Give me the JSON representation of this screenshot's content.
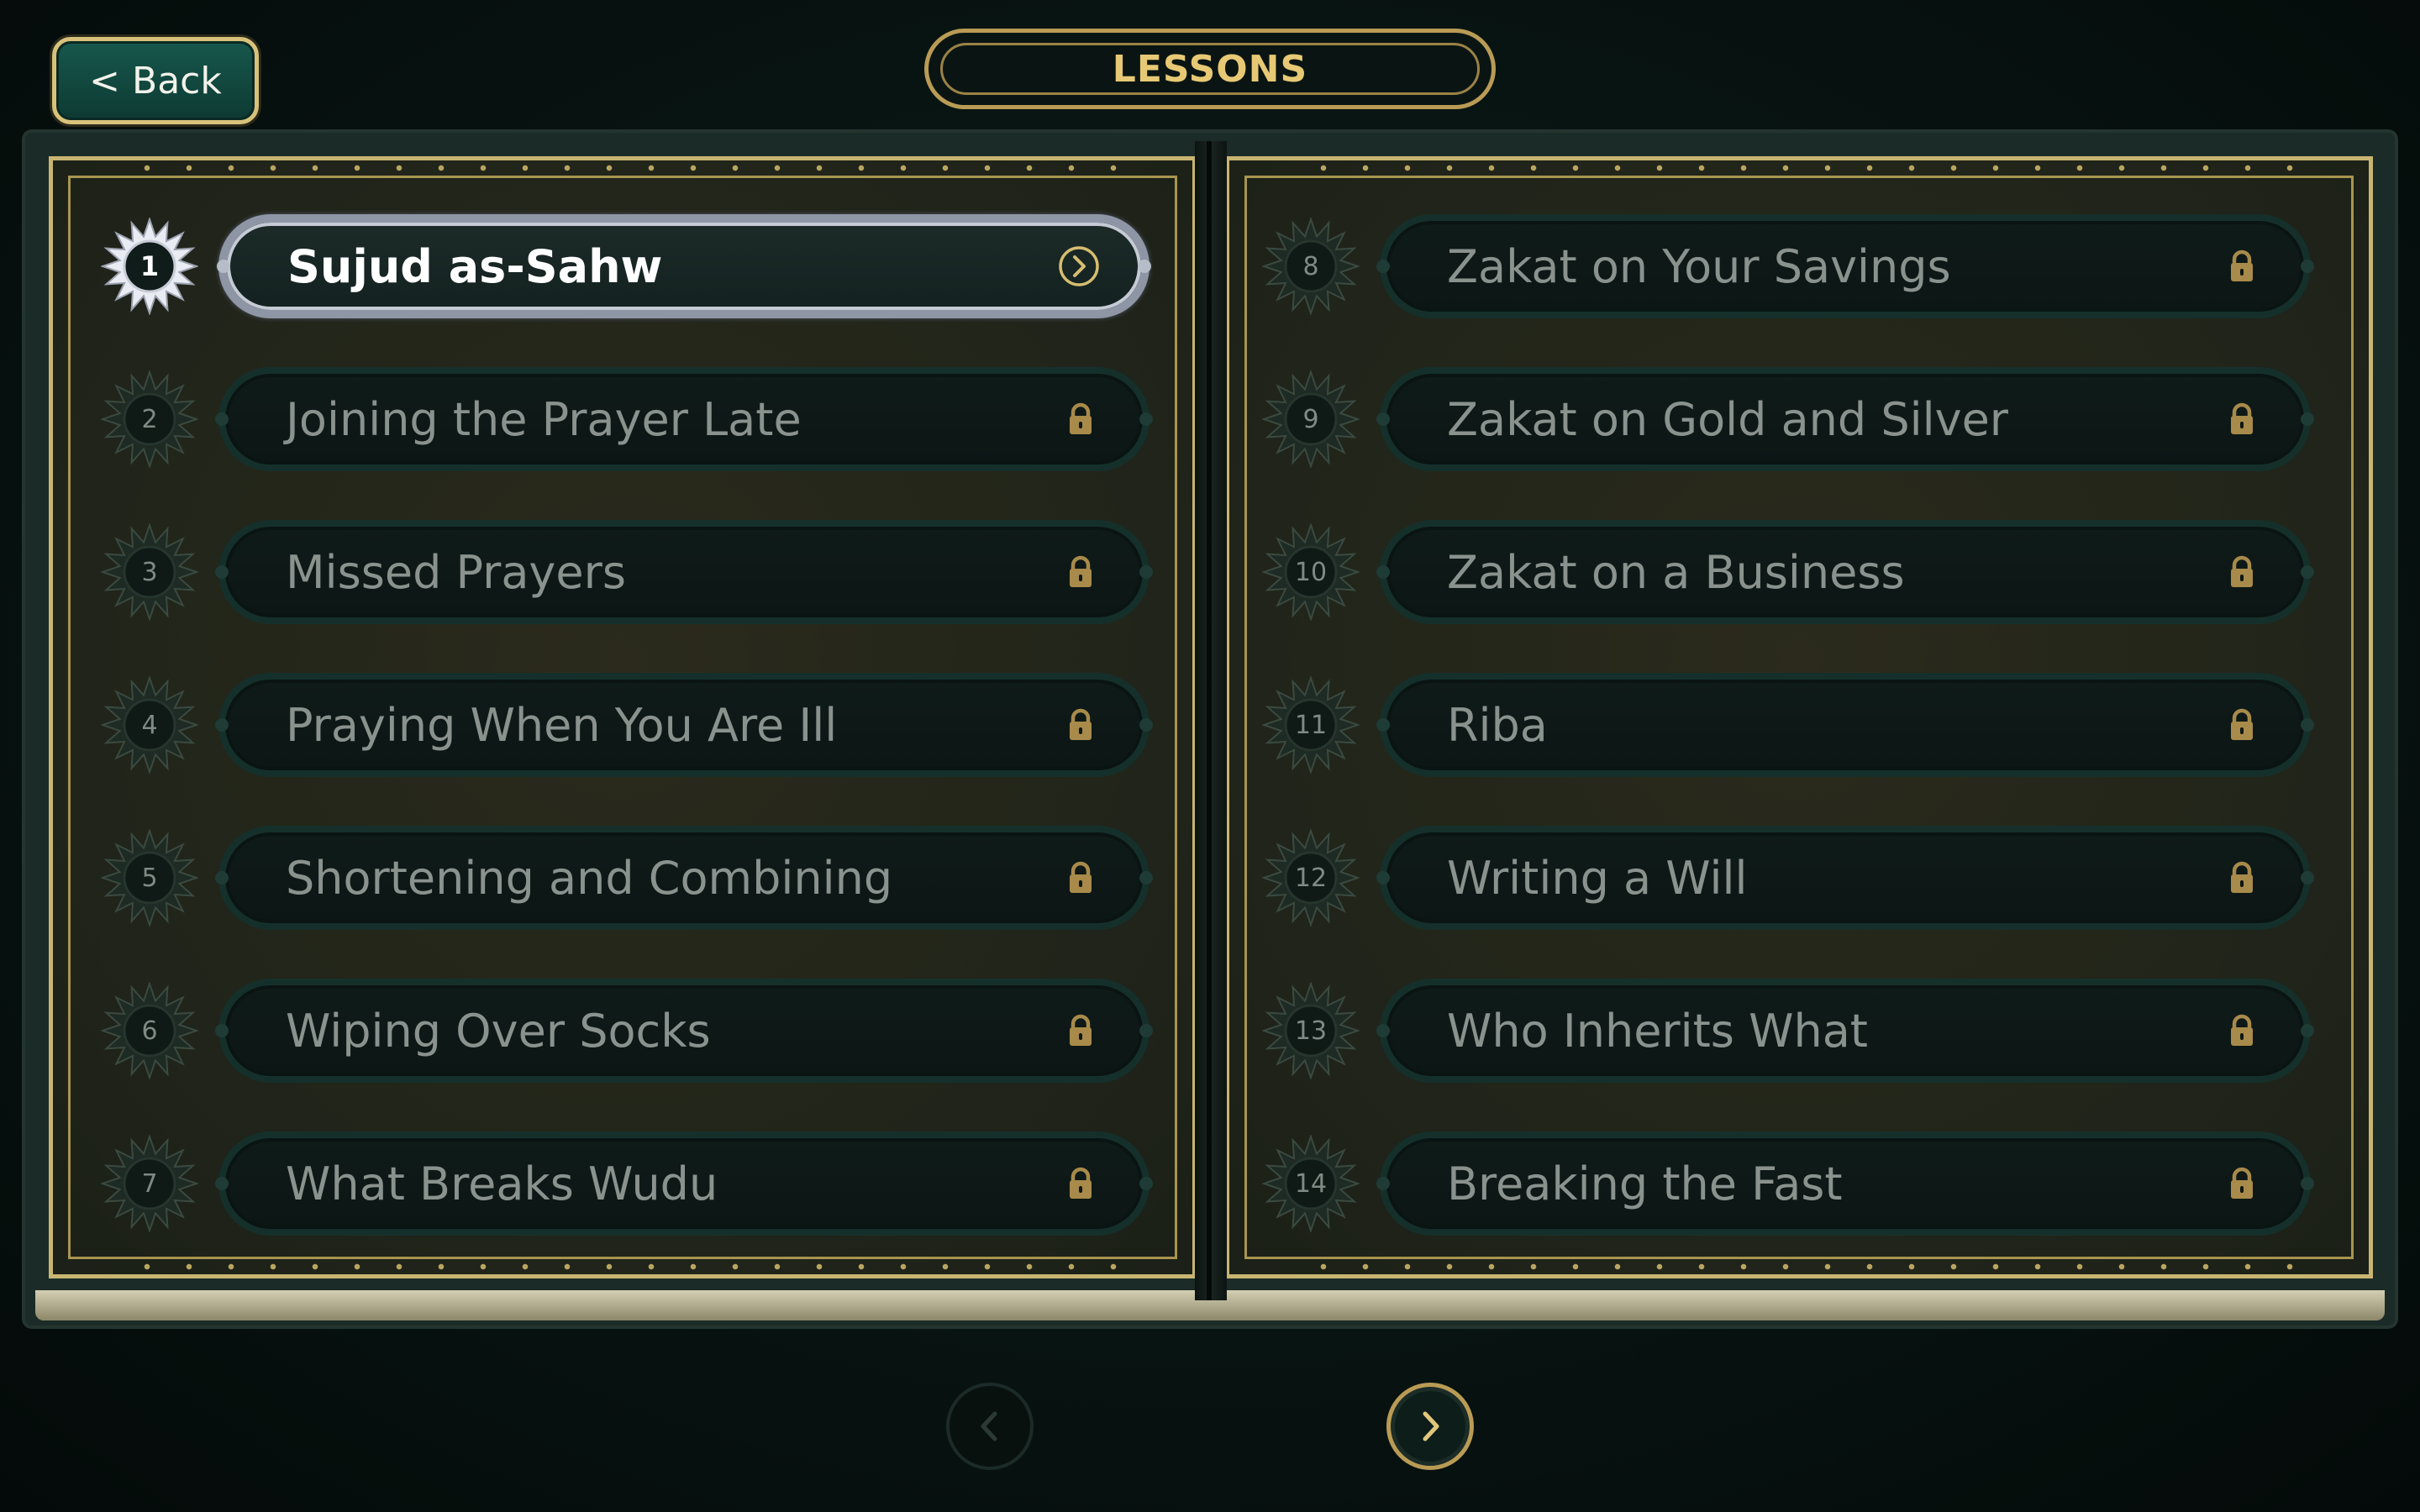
{
  "header": {
    "back_label": "< Back",
    "title": "LESSONS"
  },
  "colors": {
    "accent_gold": "#d8c27a",
    "locked_text": "#8a928e",
    "active_text": "#ffffff",
    "lock_icon": "#a88a4a"
  },
  "lessons_left": [
    {
      "number": "1",
      "title": "Sujud as-Sahw",
      "status": "unlocked",
      "icon": "chevron-right-icon"
    },
    {
      "number": "2",
      "title": "Joining the Prayer Late",
      "status": "locked",
      "icon": "lock-icon"
    },
    {
      "number": "3",
      "title": "Missed Prayers",
      "status": "locked",
      "icon": "lock-icon"
    },
    {
      "number": "4",
      "title": "Praying When You Are Ill",
      "status": "locked",
      "icon": "lock-icon"
    },
    {
      "number": "5",
      "title": "Shortening and Combining",
      "status": "locked",
      "icon": "lock-icon"
    },
    {
      "number": "6",
      "title": "Wiping Over Socks",
      "status": "locked",
      "icon": "lock-icon"
    },
    {
      "number": "7",
      "title": "What Breaks Wudu",
      "status": "locked",
      "icon": "lock-icon"
    }
  ],
  "lessons_right": [
    {
      "number": "8",
      "title": "Zakat on Your Savings",
      "status": "locked",
      "icon": "lock-icon"
    },
    {
      "number": "9",
      "title": "Zakat on Gold and Silver",
      "status": "locked",
      "icon": "lock-icon"
    },
    {
      "number": "10",
      "title": "Zakat on a Business",
      "status": "locked",
      "icon": "lock-icon"
    },
    {
      "number": "11",
      "title": "Riba",
      "status": "locked",
      "icon": "lock-icon"
    },
    {
      "number": "12",
      "title": "Writing a Will",
      "status": "locked",
      "icon": "lock-icon"
    },
    {
      "number": "13",
      "title": "Who Inherits What",
      "status": "locked",
      "icon": "lock-icon"
    },
    {
      "number": "14",
      "title": "Breaking the Fast",
      "status": "locked",
      "icon": "lock-icon"
    }
  ],
  "pagination": {
    "prev_enabled": false,
    "next_enabled": true
  }
}
